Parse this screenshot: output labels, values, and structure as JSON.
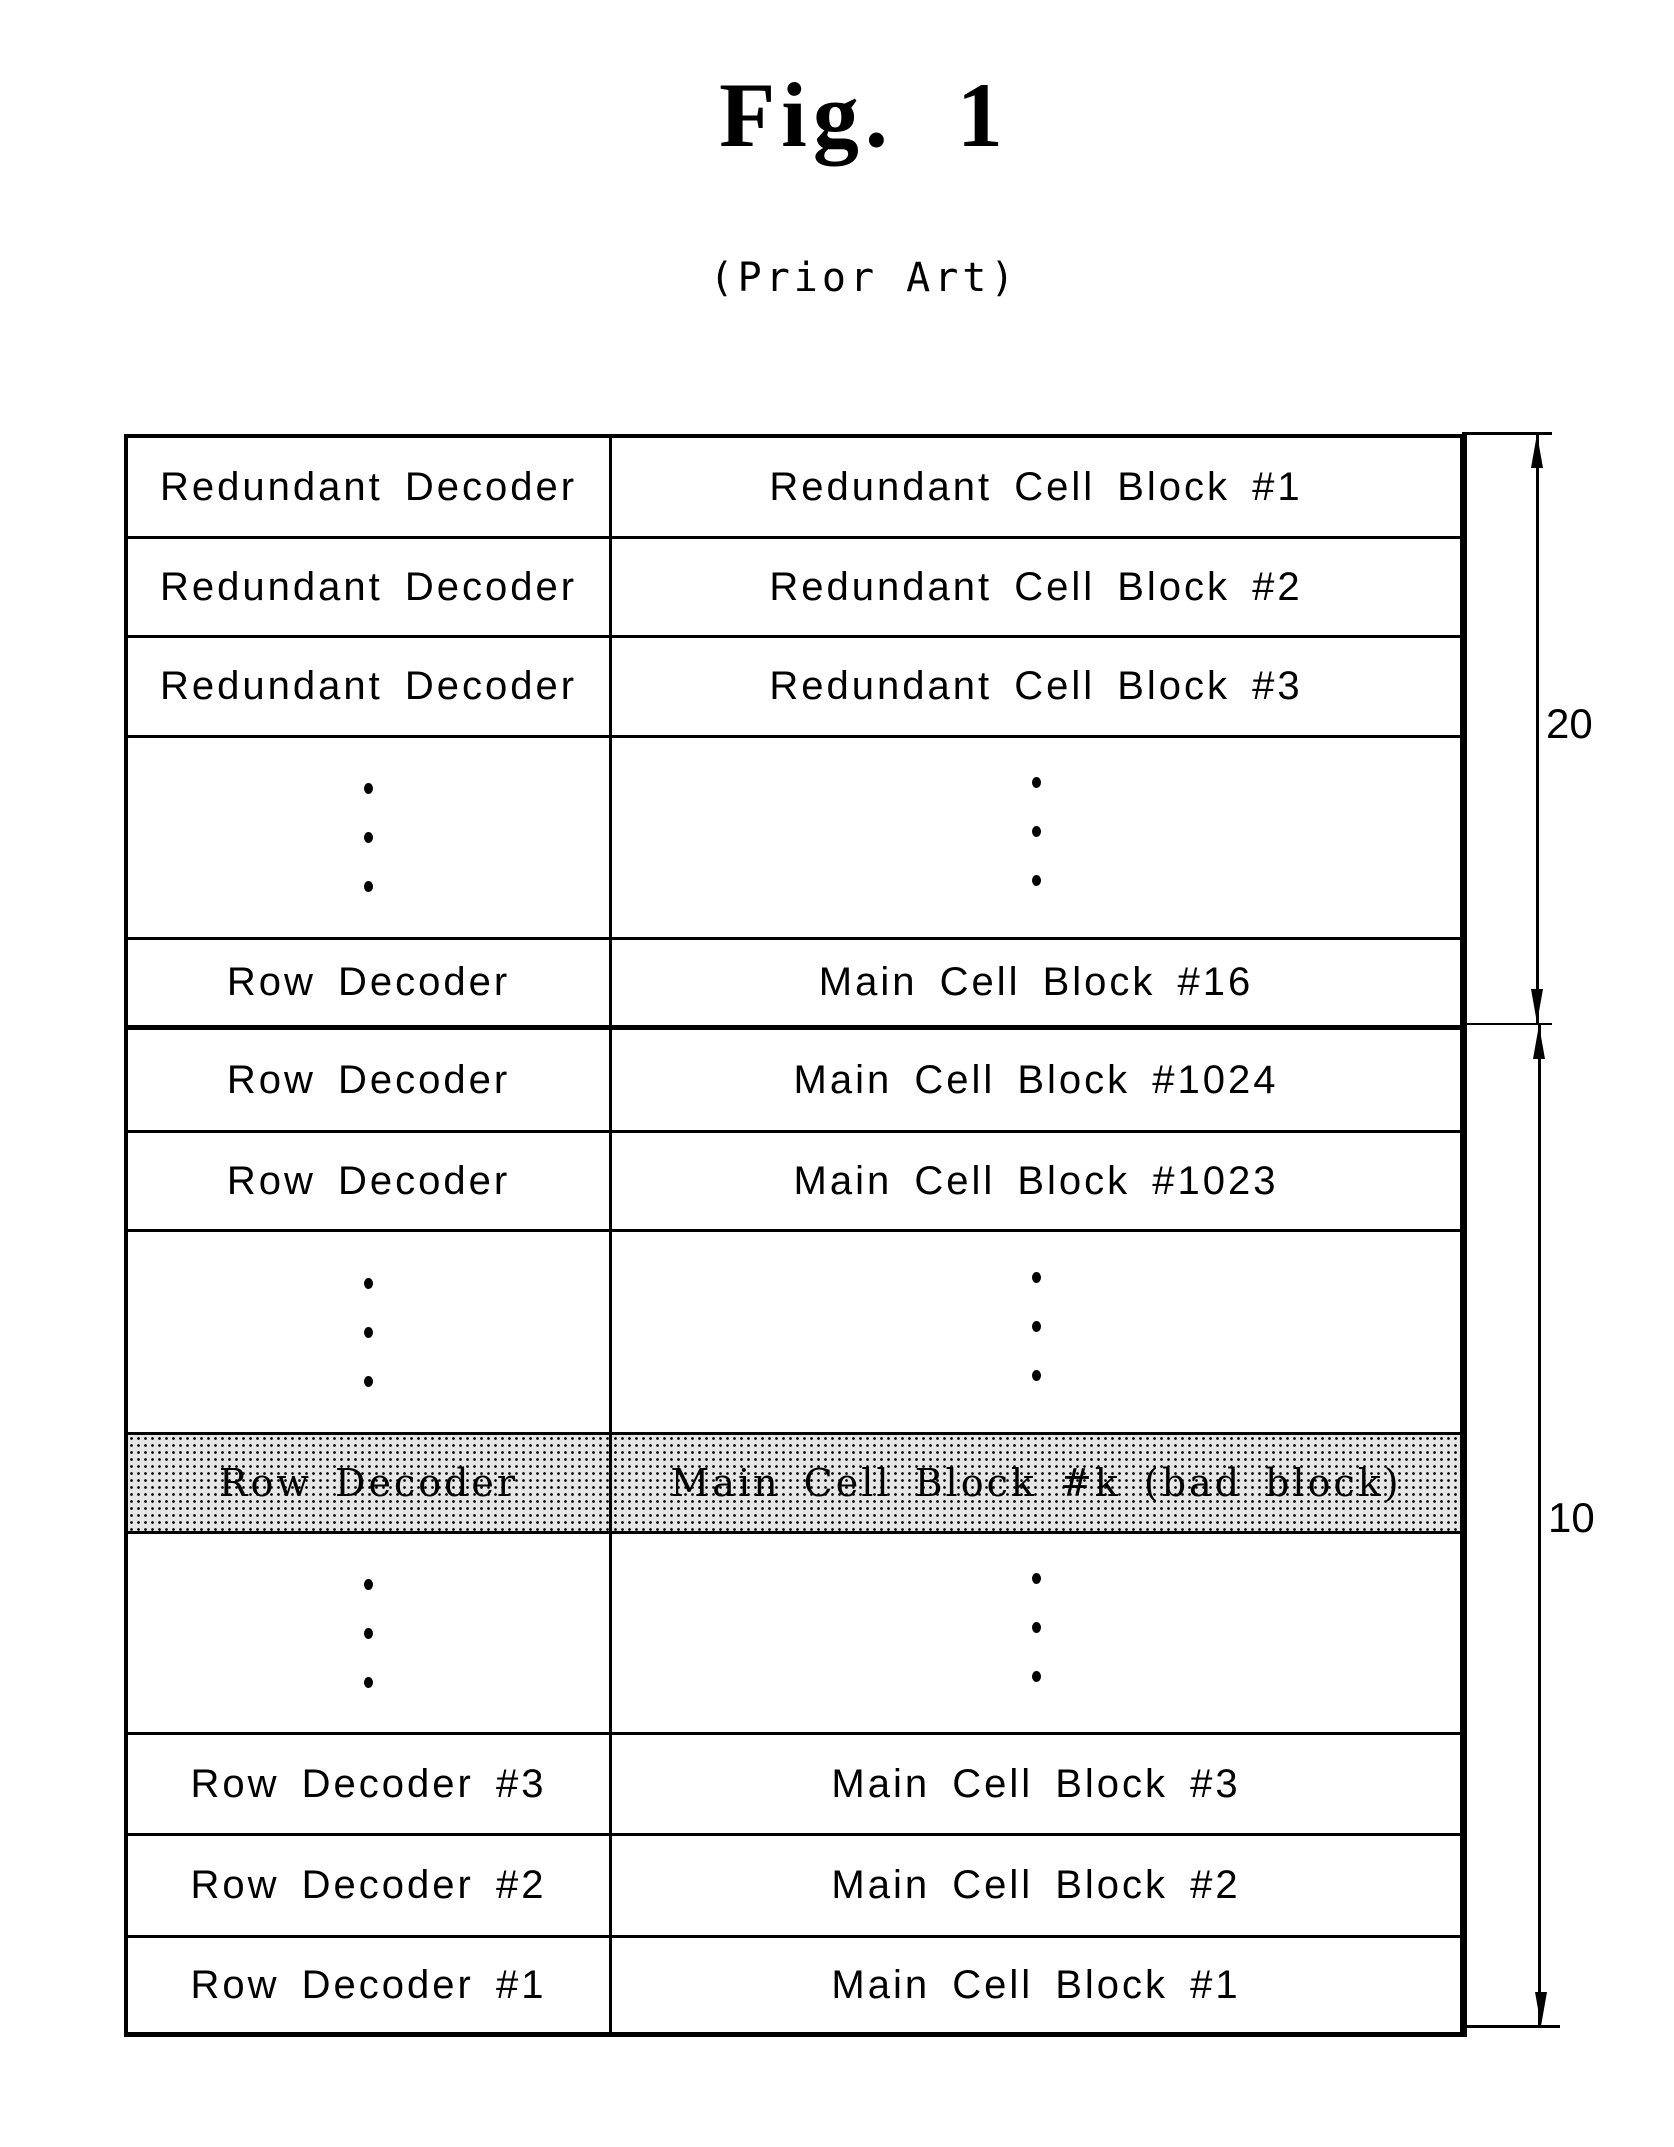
{
  "figure": {
    "title": "Fig. 1",
    "subtitle": "(Prior Art)"
  },
  "rows": [
    {
      "left": "Redundant Decoder",
      "right": "Redundant Cell Block #1",
      "kind": "text"
    },
    {
      "left": "Redundant Decoder",
      "right": "Redundant Cell Block #2",
      "kind": "text"
    },
    {
      "left": "Redundant Decoder",
      "right": "Redundant Cell Block #3",
      "kind": "text"
    },
    {
      "left": "",
      "right": "",
      "kind": "ellipsis"
    },
    {
      "left": "Row Decoder",
      "right": "Main Cell Block #16",
      "kind": "text"
    },
    {
      "left": "Row Decoder",
      "right": "Main Cell Block #1024",
      "kind": "text"
    },
    {
      "left": "Row Decoder",
      "right": "Main Cell Block #1023",
      "kind": "text"
    },
    {
      "left": "",
      "right": "",
      "kind": "ellipsis"
    },
    {
      "left": "Row Decoder",
      "right": "Main Cell Block #k (bad block)",
      "kind": "bad"
    },
    {
      "left": "",
      "right": "",
      "kind": "ellipsis"
    },
    {
      "left": "Row Decoder #3",
      "right": "Main Cell Block #3",
      "kind": "text"
    },
    {
      "left": "Row Decoder #2",
      "right": "Main Cell Block #2",
      "kind": "text"
    },
    {
      "left": "Row Decoder #1",
      "right": "Main Cell Block #1",
      "kind": "text"
    }
  ],
  "dimensions": {
    "upper_label": "20",
    "lower_label": "10"
  }
}
